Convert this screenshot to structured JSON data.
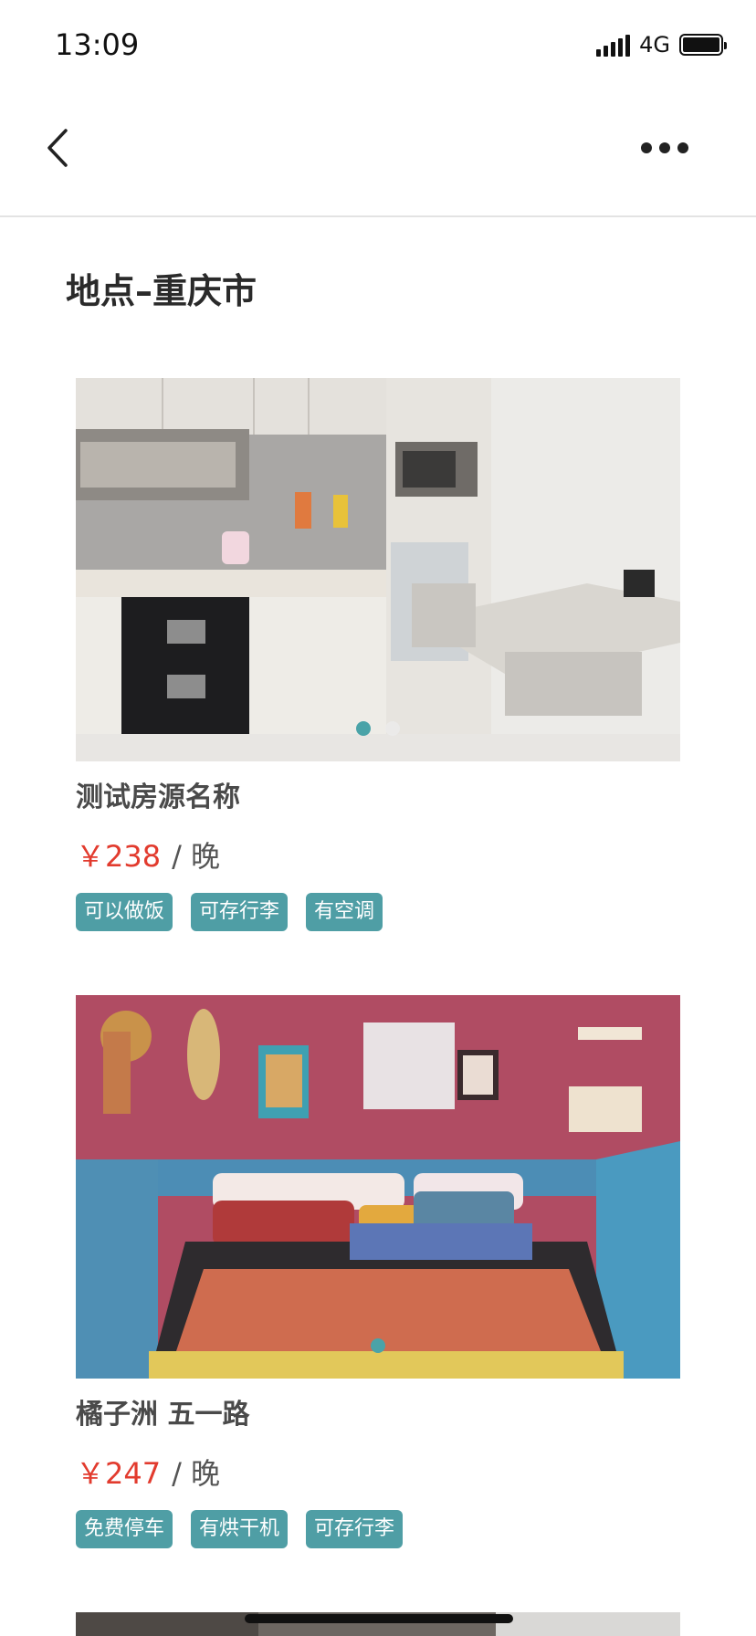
{
  "status_bar": {
    "time": "13:09",
    "network": "4G"
  },
  "header": {
    "title": "地点–重庆市"
  },
  "listings": [
    {
      "name": "测试房源名称",
      "price": "￥238",
      "unit": "/ 晚",
      "tags": [
        "可以做饭",
        "可存行李",
        "有空调"
      ],
      "photo": "kitchen-dining-photo",
      "dots_count": 2,
      "active_dot": 0
    },
    {
      "name": "橘子洲 五一路",
      "price": "￥247",
      "unit": "/ 晚",
      "tags": [
        "免费停车",
        "有烘干机",
        "可存行李"
      ],
      "photo": "bohemian-bedroom-photo",
      "dots_count": 1,
      "active_dot": 0
    }
  ],
  "colors": {
    "price": "#e23b2e",
    "tag_bg": "#4f9ea5",
    "dot_active": "#4aa3a8"
  }
}
